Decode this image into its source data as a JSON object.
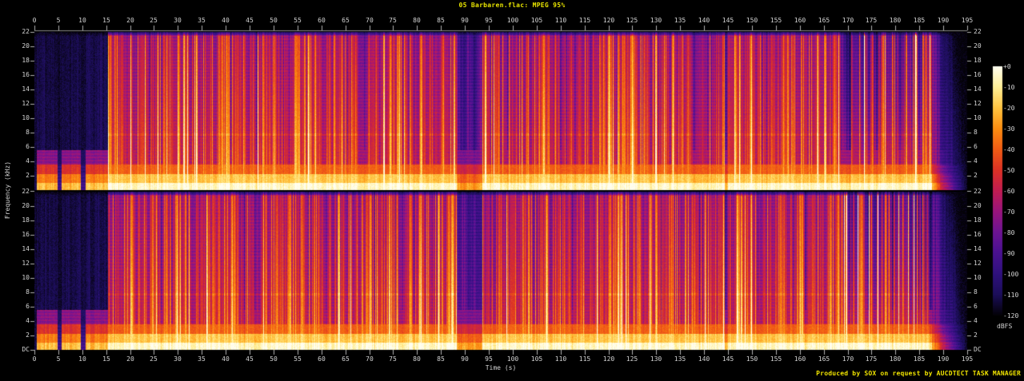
{
  "header": {
    "title": "05 Barbaren.flac: MPEG 95%"
  },
  "footer": {
    "credit": "Produced by SOX on request by AUCDTECT TASK MANAGER"
  },
  "axes": {
    "time_label": "Time (s)",
    "freq_label": "Frequency (kHz)",
    "time_ticks": [
      0,
      5,
      10,
      15,
      20,
      25,
      30,
      35,
      40,
      45,
      50,
      55,
      60,
      65,
      70,
      75,
      80,
      85,
      90,
      95,
      100,
      105,
      110,
      115,
      120,
      125,
      130,
      135,
      140,
      145,
      150,
      155,
      160,
      165,
      170,
      175,
      180,
      185,
      190,
      195
    ],
    "freq_ticks": [
      "22",
      "20",
      "18",
      "16",
      "14",
      "12",
      "10",
      "8",
      "6",
      "4",
      "2"
    ],
    "dc_label": "DC"
  },
  "colorbar": {
    "unit": "dBFS",
    "labels": [
      "+0",
      "-10",
      "-20",
      "-30",
      "-40",
      "-50",
      "-60",
      "-70",
      "-80",
      "-90",
      "-100",
      "-110",
      "-120"
    ]
  },
  "colors": {
    "background": "#000000",
    "title_text": "#e8e400",
    "footer_text": "#f0e400",
    "tick_text": "#d4d4d4",
    "tick_mark": "#b0b0b0",
    "axis_line": "#8a8a8a"
  },
  "chart_data": {
    "type": "heatmap",
    "subtype": "audio-spectrogram",
    "title": "05 Barbaren.flac: MPEG 95%",
    "xlabel": "Time (s)",
    "ylabel": "Frequency (kHz)",
    "x_range_s": [
      0,
      195
    ],
    "x_tick_step_s": 5,
    "y_range_khz": [
      0,
      22
    ],
    "y_tick_step_khz": 2,
    "channels": 2,
    "channel_layout": "two stacked panels, top = channel 1, bottom = channel 2, DC at bottom of each panel",
    "intensity_scale": {
      "unit": "dBFS",
      "max": 0,
      "min": -120,
      "tick_step": 10,
      "legend_position": "right colorbar"
    },
    "palette_stops": [
      [
        0.0,
        "#040208"
      ],
      [
        0.083,
        "#1c0e5a"
      ],
      [
        0.167,
        "#30117e"
      ],
      [
        0.25,
        "#4a1190"
      ],
      [
        0.333,
        "#6d1493"
      ],
      [
        0.417,
        "#9a157d"
      ],
      [
        0.5,
        "#c11d52"
      ],
      [
        0.583,
        "#dc3226"
      ],
      [
        0.667,
        "#f15c15"
      ],
      [
        0.75,
        "#fb8d11"
      ],
      [
        0.833,
        "#ffc440"
      ],
      [
        0.917,
        "#ffef96"
      ],
      [
        1.0,
        "#fffef0"
      ]
    ],
    "envelope_segments": [
      {
        "t0": 0.0,
        "t1": 0.4,
        "broad": 0.06,
        "low": 0.08
      },
      {
        "t0": 0.4,
        "t1": 4.7,
        "broad": 0.1,
        "low": 0.85
      },
      {
        "t0": 4.7,
        "t1": 5.6,
        "broad": 0.07,
        "low": 0.22
      },
      {
        "t0": 5.6,
        "t1": 9.6,
        "broad": 0.1,
        "low": 0.85
      },
      {
        "t0": 9.6,
        "t1": 10.6,
        "broad": 0.07,
        "low": 0.22
      },
      {
        "t0": 10.6,
        "t1": 15.3,
        "broad": 0.11,
        "low": 0.85
      },
      {
        "t0": 15.3,
        "t1": 88.2,
        "broad": 0.85,
        "low": 1.0
      },
      {
        "t0": 88.2,
        "t1": 93.6,
        "broad": 0.4,
        "low": 0.8
      },
      {
        "t0": 93.6,
        "t1": 144.2,
        "broad": 0.85,
        "low": 1.0
      },
      {
        "t0": 144.2,
        "t1": 144.9,
        "broad": 0.45,
        "low": 0.85
      },
      {
        "t0": 144.9,
        "t1": 169.0,
        "broad": 0.85,
        "low": 1.0
      },
      {
        "t0": 169.0,
        "t1": 187.5,
        "broad": 0.83,
        "low": 1.0,
        "contrast": true
      },
      {
        "t0": 187.5,
        "t1": 195.0,
        "broad": 0.55,
        "low": 0.85,
        "fade": true
      }
    ],
    "structure_events": [
      {
        "t_start": 0,
        "t_end": 15.3,
        "description": "quiet intro with three low-frequency pulses separated by short gaps"
      },
      {
        "t_start": 15.3,
        "t_end": 88.2,
        "description": "full-band loud music with dense vertical beat striations up to 22 kHz"
      },
      {
        "t_start": 88.2,
        "t_end": 93.6,
        "description": "quiet breakdown (dark purple band, low band persists)"
      },
      {
        "t_start": 93.6,
        "t_end": 144.2,
        "description": "full-band loud music"
      },
      {
        "t_start": 144.2,
        "t_end": 144.9,
        "description": "one-beat gap (narrow dark column)"
      },
      {
        "t_start": 144.9,
        "t_end": 187.5,
        "description": "loud outro; after ~169 s discrete beats with dark gaps at high frequencies"
      },
      {
        "t_start": 187.5,
        "t_end": 195,
        "description": "fade-out decay wedge, high frequencies die first"
      }
    ]
  }
}
